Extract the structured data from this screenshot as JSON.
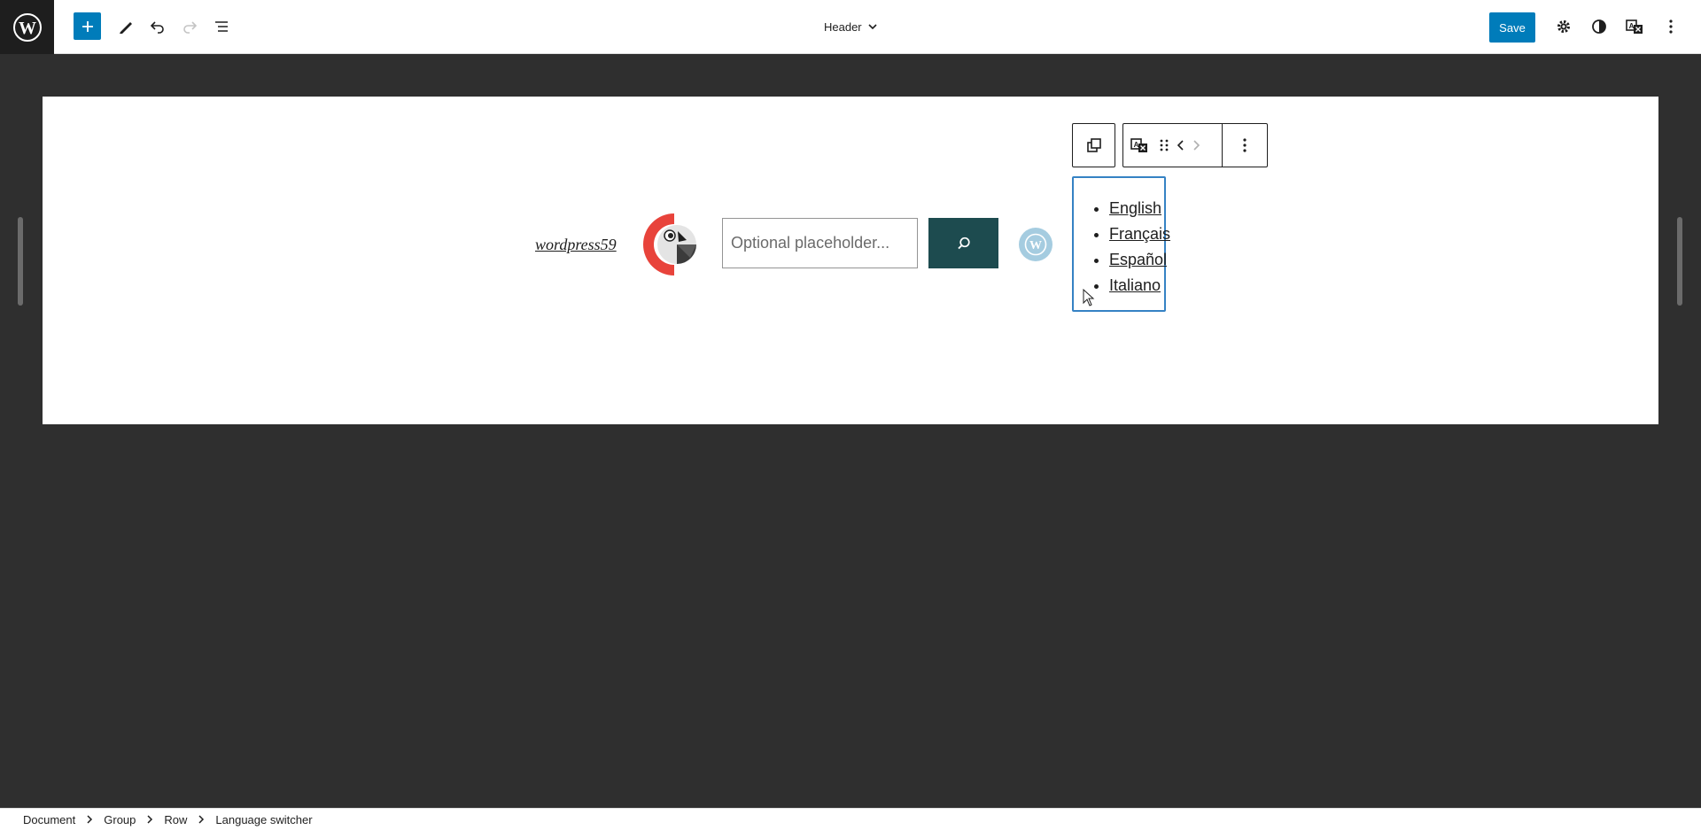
{
  "toolbar": {
    "add_label": "+",
    "document_title": "Header",
    "save_label": "Save"
  },
  "canvas": {
    "site_title": "wordpress59",
    "search": {
      "placeholder": "Optional placeholder..."
    }
  },
  "language_switcher": {
    "items": [
      "English",
      "Français",
      "Español",
      "Italiano"
    ]
  },
  "breadcrumb": [
    "Document",
    "Group",
    "Row",
    "Language switcher"
  ],
  "colors": {
    "accent": "#007cba",
    "search_button": "#1d4b4f",
    "selection_outline": "#3582c4",
    "editor_background": "#2f2f2f"
  }
}
